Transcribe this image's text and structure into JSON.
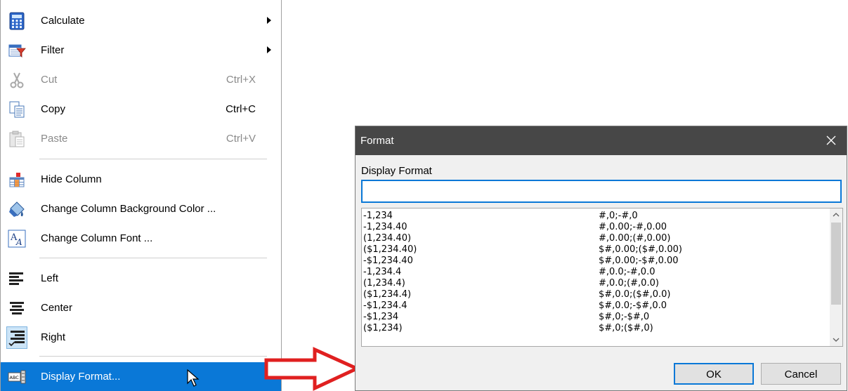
{
  "context_menu": {
    "items": [
      {
        "label": "Calculate",
        "shortcut": "",
        "submenu": true,
        "icon": "calculator-icon"
      },
      {
        "label": "Filter",
        "shortcut": "",
        "submenu": true,
        "icon": "filter-icon"
      },
      {
        "label": "Cut",
        "shortcut": "Ctrl+X",
        "disabled": true,
        "icon": "scissors-icon"
      },
      {
        "label": "Copy",
        "shortcut": "Ctrl+C",
        "icon": "copy-icon"
      },
      {
        "label": "Paste",
        "shortcut": "Ctrl+V",
        "disabled": true,
        "icon": "paste-icon"
      },
      {
        "label": "Hide Column",
        "icon": "hide-column-icon"
      },
      {
        "label": "Change Column Background Color ...",
        "icon": "paint-bucket-icon"
      },
      {
        "label": "Change Column Font ...",
        "icon": "font-icon"
      },
      {
        "label": "Left",
        "icon": "align-left-icon"
      },
      {
        "label": "Center",
        "icon": "align-center-icon"
      },
      {
        "label": "Right",
        "icon": "align-right-icon",
        "checked": true
      },
      {
        "label": "Display Format...",
        "icon": "display-format-icon",
        "selected": true
      }
    ]
  },
  "dialog": {
    "title": "Format",
    "display_format_label": "Display Format",
    "display_format_value": "",
    "formats": [
      {
        "sample": "-1,234",
        "pattern": "#,0;-#,0"
      },
      {
        "sample": "-1,234.40",
        "pattern": "#,0.00;-#,0.00"
      },
      {
        "sample": "(1,234.40)",
        "pattern": "#,0.00;(#,0.00)"
      },
      {
        "sample": "($1,234.40)",
        "pattern": "$#,0.00;($#,0.00)"
      },
      {
        "sample": "-$1,234.40",
        "pattern": "$#,0.00;-$#,0.00"
      },
      {
        "sample": "-1,234.4",
        "pattern": "#,0.0;-#,0.0"
      },
      {
        "sample": "(1,234.4)",
        "pattern": "#,0.0;(#,0.0)"
      },
      {
        "sample": "($1,234.4)",
        "pattern": "$#,0.0;($#,0.0)"
      },
      {
        "sample": "-$1,234.4",
        "pattern": "$#,0.0;-$#,0.0"
      },
      {
        "sample": "-$1,234",
        "pattern": "$#,0;-$#,0"
      },
      {
        "sample": "($1,234)",
        "pattern": "$#,0;($#,0)"
      }
    ],
    "ok_label": "OK",
    "cancel_label": "Cancel"
  },
  "colors": {
    "accent": "#0a78d7",
    "titlebar": "#474747",
    "arrow": "#e02020"
  }
}
